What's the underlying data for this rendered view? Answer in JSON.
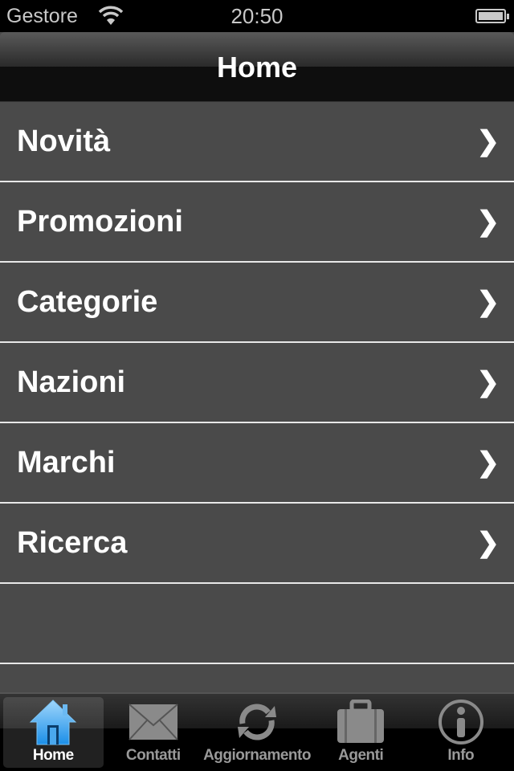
{
  "status": {
    "carrier": "Gestore",
    "time": "20:50"
  },
  "nav": {
    "title": "Home"
  },
  "menu": [
    {
      "label": "Novità"
    },
    {
      "label": "Promozioni"
    },
    {
      "label": "Categorie"
    },
    {
      "label": "Nazioni"
    },
    {
      "label": "Marchi"
    },
    {
      "label": "Ricerca"
    }
  ],
  "tabs": [
    {
      "label": "Home",
      "icon": "home-icon",
      "active": true
    },
    {
      "label": "Contatti",
      "icon": "envelope-icon"
    },
    {
      "label": "Aggiornamento",
      "icon": "refresh-icon"
    },
    {
      "label": "Agenti",
      "icon": "briefcase-icon"
    },
    {
      "label": "Info",
      "icon": "info-icon"
    }
  ],
  "colors": {
    "active_icon": "#3aa6f0",
    "row_bg": "#4a4a4a"
  }
}
